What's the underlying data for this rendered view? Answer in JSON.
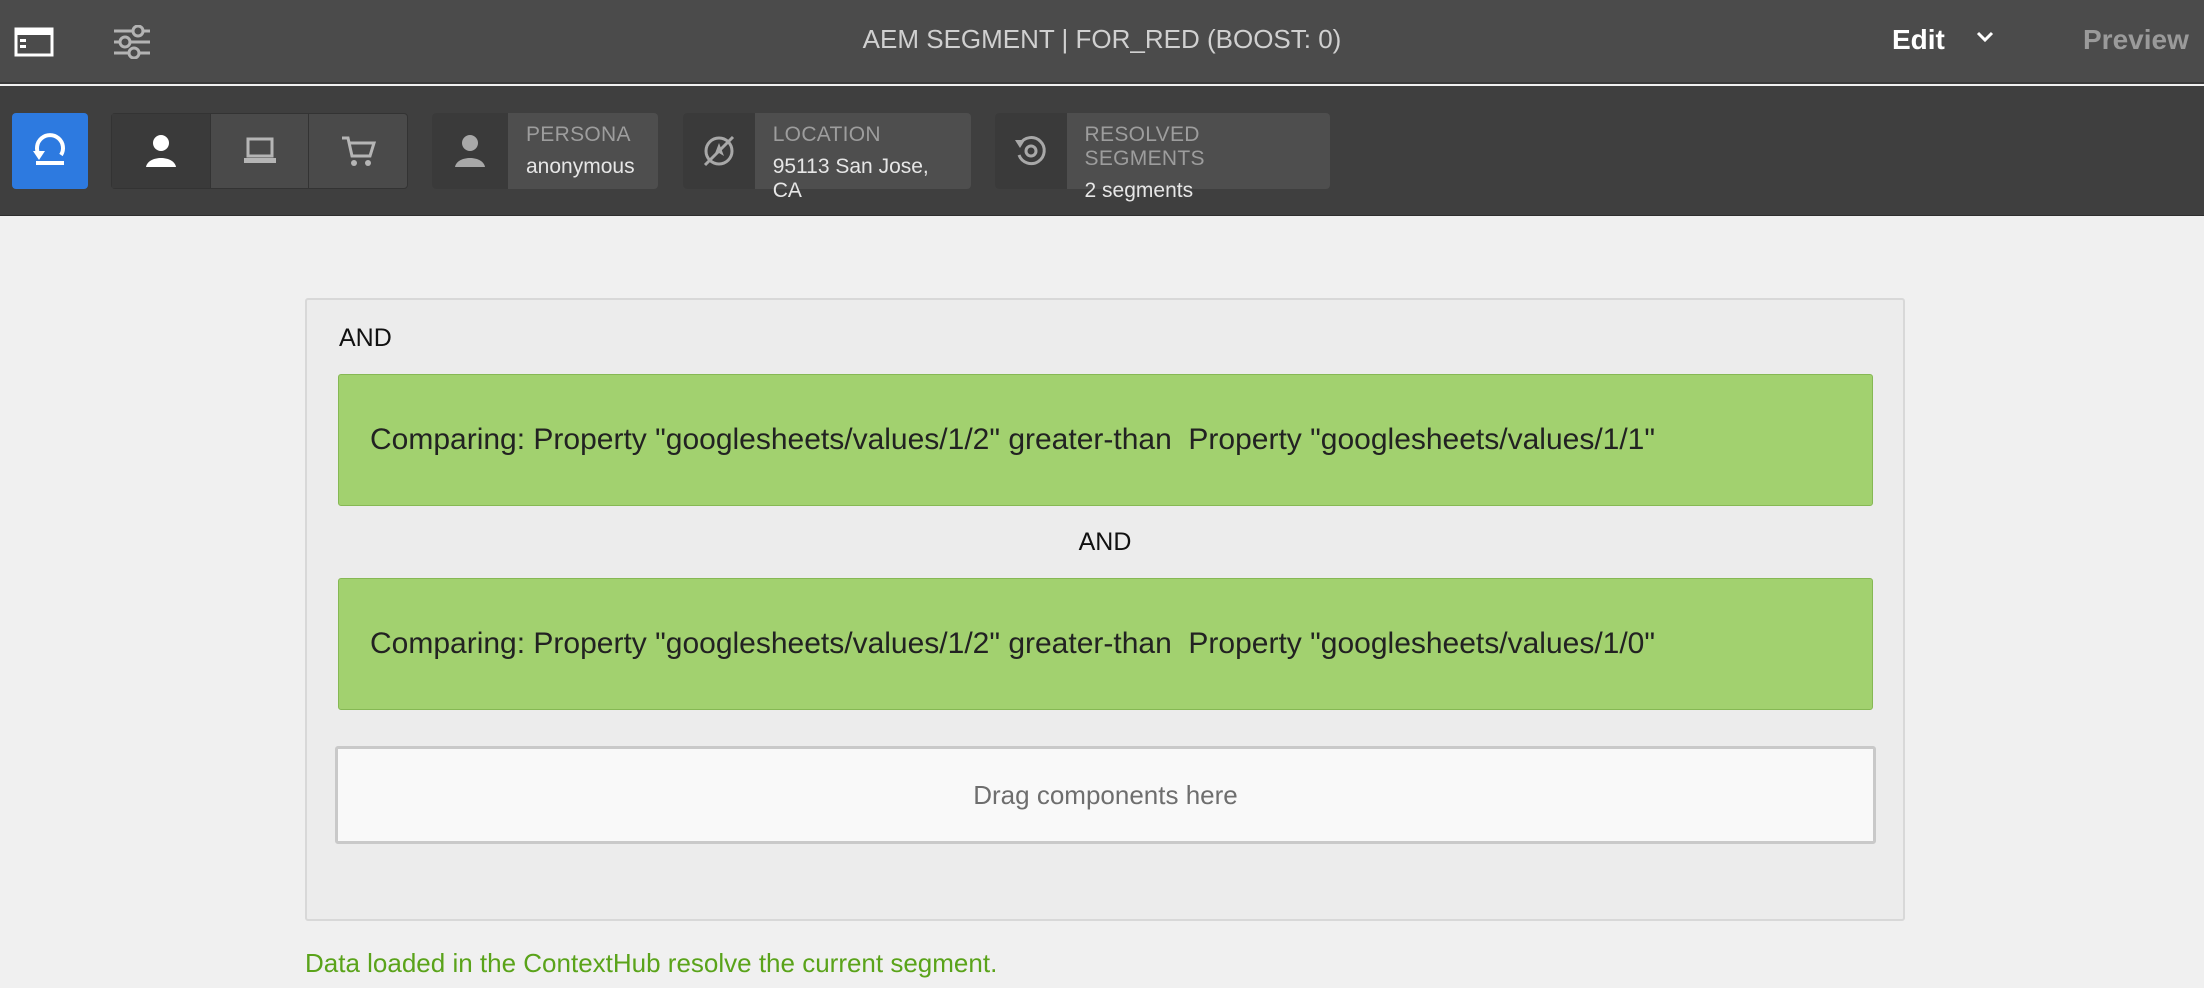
{
  "topbar": {
    "title": "AEM SEGMENT | FOR_RED (BOOST: 0)",
    "mode_label": "Edit",
    "preview_label": "Preview",
    "icons": [
      "sidepanel-icon",
      "properties-icon",
      "chevron-down-icon"
    ]
  },
  "contexthub": {
    "active_segment": "persona",
    "cards": {
      "persona": {
        "label": "PERSONA",
        "value": "anonymous"
      },
      "location": {
        "label": "LOCATION",
        "value": "95113 San Jose, CA"
      },
      "segments": {
        "label": "RESOLVED SEGMENTS",
        "value": "2 segments"
      }
    },
    "colors": {
      "accent": "#2d7ae0",
      "bar": "#3f3f3f",
      "top": "#4b4b4b"
    }
  },
  "editor": {
    "container_operator": "AND",
    "conditions": [
      {
        "text": "Comparing: Property \"googlesheets/values/1/2\" greater-than  Property \"googlesheets/values/1/1\""
      },
      {
        "text": "Comparing: Property \"googlesheets/values/1/2\" greater-than  Property \"googlesheets/values/1/0\""
      }
    ],
    "between_operator": "AND",
    "dropzone_label": "Drag components here",
    "status_text": "Data loaded in the ContextHub resolve the current segment.",
    "colors": {
      "condition_bg": "#a2d16f",
      "status_text": "#5aa31a"
    }
  }
}
